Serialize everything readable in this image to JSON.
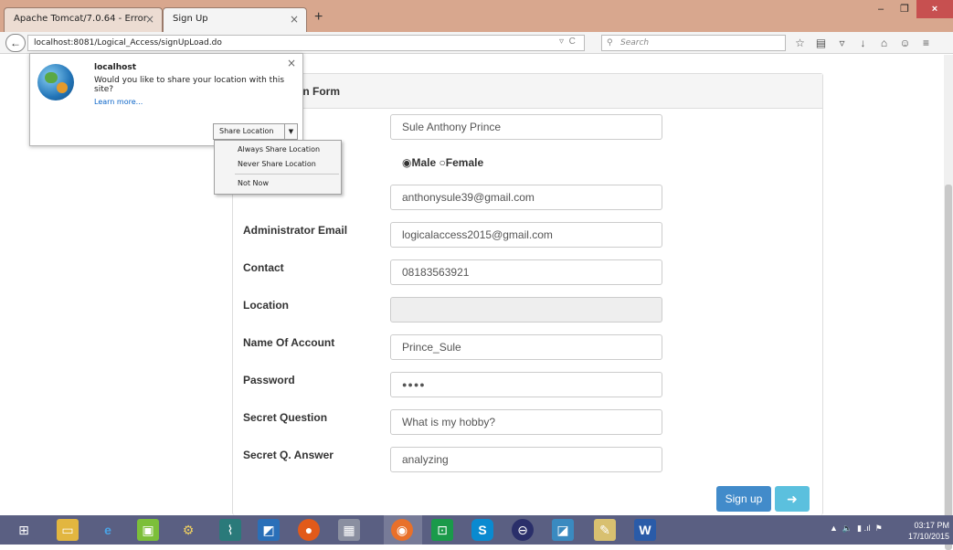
{
  "browser": {
    "tabs": [
      {
        "label": "Apache Tomcat/7.0.64 - Error ...",
        "close": "×"
      },
      {
        "label": "Sign Up",
        "close": "×"
      }
    ],
    "new_tab": "+",
    "url": "localhost:8081/Logical_Access/signUpLoad.do",
    "search_placeholder": "Search",
    "window_controls": {
      "minimize": "–",
      "maximize": "❐",
      "close": "×"
    }
  },
  "geo_popup": {
    "host": "localhost",
    "message": "Would you like to share your location with this site?",
    "learn_more": "Learn more...",
    "share_button": "Share Location",
    "menu": [
      "Always Share Location",
      "Never Share Location",
      "Not Now"
    ]
  },
  "form": {
    "panel_title": "on Form",
    "full_name": "Sule Anthony Prince",
    "gender_male": "Male",
    "gender_female": "Female",
    "gender_selected": "Male",
    "fields": [
      {
        "label": "Administrator Email",
        "value": "logicalaccess2015@gmail.com"
      },
      {
        "label": "Contact",
        "value": "08183563921"
      },
      {
        "label": "Location",
        "value": ""
      },
      {
        "label": "Name Of Account",
        "value": "Prince_Sule"
      },
      {
        "label": "Password",
        "value": "●●●●"
      },
      {
        "label": "Secret Question",
        "value": "What is my hobby?"
      },
      {
        "label": "Secret Q. Answer",
        "value": "analyzing"
      }
    ],
    "email_value": "anthonysule39@gmail.com",
    "signup_button": "Sign up",
    "signin_icon": "➜"
  },
  "taskbar": {
    "time": "03:17 PM",
    "date": "17/10/2015"
  }
}
